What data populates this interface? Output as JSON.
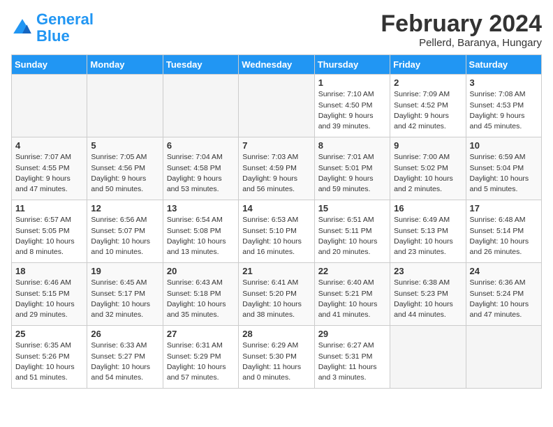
{
  "header": {
    "logo_general": "General",
    "logo_blue": "Blue",
    "month_title": "February 2024",
    "location": "Pellerd, Baranya, Hungary"
  },
  "calendar": {
    "days_of_week": [
      "Sunday",
      "Monday",
      "Tuesday",
      "Wednesday",
      "Thursday",
      "Friday",
      "Saturday"
    ],
    "weeks": [
      [
        {
          "day": "",
          "detail": ""
        },
        {
          "day": "",
          "detail": ""
        },
        {
          "day": "",
          "detail": ""
        },
        {
          "day": "",
          "detail": ""
        },
        {
          "day": "1",
          "detail": "Sunrise: 7:10 AM\nSunset: 4:50 PM\nDaylight: 9 hours\nand 39 minutes."
        },
        {
          "day": "2",
          "detail": "Sunrise: 7:09 AM\nSunset: 4:52 PM\nDaylight: 9 hours\nand 42 minutes."
        },
        {
          "day": "3",
          "detail": "Sunrise: 7:08 AM\nSunset: 4:53 PM\nDaylight: 9 hours\nand 45 minutes."
        }
      ],
      [
        {
          "day": "4",
          "detail": "Sunrise: 7:07 AM\nSunset: 4:55 PM\nDaylight: 9 hours\nand 47 minutes."
        },
        {
          "day": "5",
          "detail": "Sunrise: 7:05 AM\nSunset: 4:56 PM\nDaylight: 9 hours\nand 50 minutes."
        },
        {
          "day": "6",
          "detail": "Sunrise: 7:04 AM\nSunset: 4:58 PM\nDaylight: 9 hours\nand 53 minutes."
        },
        {
          "day": "7",
          "detail": "Sunrise: 7:03 AM\nSunset: 4:59 PM\nDaylight: 9 hours\nand 56 minutes."
        },
        {
          "day": "8",
          "detail": "Sunrise: 7:01 AM\nSunset: 5:01 PM\nDaylight: 9 hours\nand 59 minutes."
        },
        {
          "day": "9",
          "detail": "Sunrise: 7:00 AM\nSunset: 5:02 PM\nDaylight: 10 hours\nand 2 minutes."
        },
        {
          "day": "10",
          "detail": "Sunrise: 6:59 AM\nSunset: 5:04 PM\nDaylight: 10 hours\nand 5 minutes."
        }
      ],
      [
        {
          "day": "11",
          "detail": "Sunrise: 6:57 AM\nSunset: 5:05 PM\nDaylight: 10 hours\nand 8 minutes."
        },
        {
          "day": "12",
          "detail": "Sunrise: 6:56 AM\nSunset: 5:07 PM\nDaylight: 10 hours\nand 10 minutes."
        },
        {
          "day": "13",
          "detail": "Sunrise: 6:54 AM\nSunset: 5:08 PM\nDaylight: 10 hours\nand 13 minutes."
        },
        {
          "day": "14",
          "detail": "Sunrise: 6:53 AM\nSunset: 5:10 PM\nDaylight: 10 hours\nand 16 minutes."
        },
        {
          "day": "15",
          "detail": "Sunrise: 6:51 AM\nSunset: 5:11 PM\nDaylight: 10 hours\nand 20 minutes."
        },
        {
          "day": "16",
          "detail": "Sunrise: 6:49 AM\nSunset: 5:13 PM\nDaylight: 10 hours\nand 23 minutes."
        },
        {
          "day": "17",
          "detail": "Sunrise: 6:48 AM\nSunset: 5:14 PM\nDaylight: 10 hours\nand 26 minutes."
        }
      ],
      [
        {
          "day": "18",
          "detail": "Sunrise: 6:46 AM\nSunset: 5:15 PM\nDaylight: 10 hours\nand 29 minutes."
        },
        {
          "day": "19",
          "detail": "Sunrise: 6:45 AM\nSunset: 5:17 PM\nDaylight: 10 hours\nand 32 minutes."
        },
        {
          "day": "20",
          "detail": "Sunrise: 6:43 AM\nSunset: 5:18 PM\nDaylight: 10 hours\nand 35 minutes."
        },
        {
          "day": "21",
          "detail": "Sunrise: 6:41 AM\nSunset: 5:20 PM\nDaylight: 10 hours\nand 38 minutes."
        },
        {
          "day": "22",
          "detail": "Sunrise: 6:40 AM\nSunset: 5:21 PM\nDaylight: 10 hours\nand 41 minutes."
        },
        {
          "day": "23",
          "detail": "Sunrise: 6:38 AM\nSunset: 5:23 PM\nDaylight: 10 hours\nand 44 minutes."
        },
        {
          "day": "24",
          "detail": "Sunrise: 6:36 AM\nSunset: 5:24 PM\nDaylight: 10 hours\nand 47 minutes."
        }
      ],
      [
        {
          "day": "25",
          "detail": "Sunrise: 6:35 AM\nSunset: 5:26 PM\nDaylight: 10 hours\nand 51 minutes."
        },
        {
          "day": "26",
          "detail": "Sunrise: 6:33 AM\nSunset: 5:27 PM\nDaylight: 10 hours\nand 54 minutes."
        },
        {
          "day": "27",
          "detail": "Sunrise: 6:31 AM\nSunset: 5:29 PM\nDaylight: 10 hours\nand 57 minutes."
        },
        {
          "day": "28",
          "detail": "Sunrise: 6:29 AM\nSunset: 5:30 PM\nDaylight: 11 hours\nand 0 minutes."
        },
        {
          "day": "29",
          "detail": "Sunrise: 6:27 AM\nSunset: 5:31 PM\nDaylight: 11 hours\nand 3 minutes."
        },
        {
          "day": "",
          "detail": ""
        },
        {
          "day": "",
          "detail": ""
        }
      ]
    ]
  }
}
